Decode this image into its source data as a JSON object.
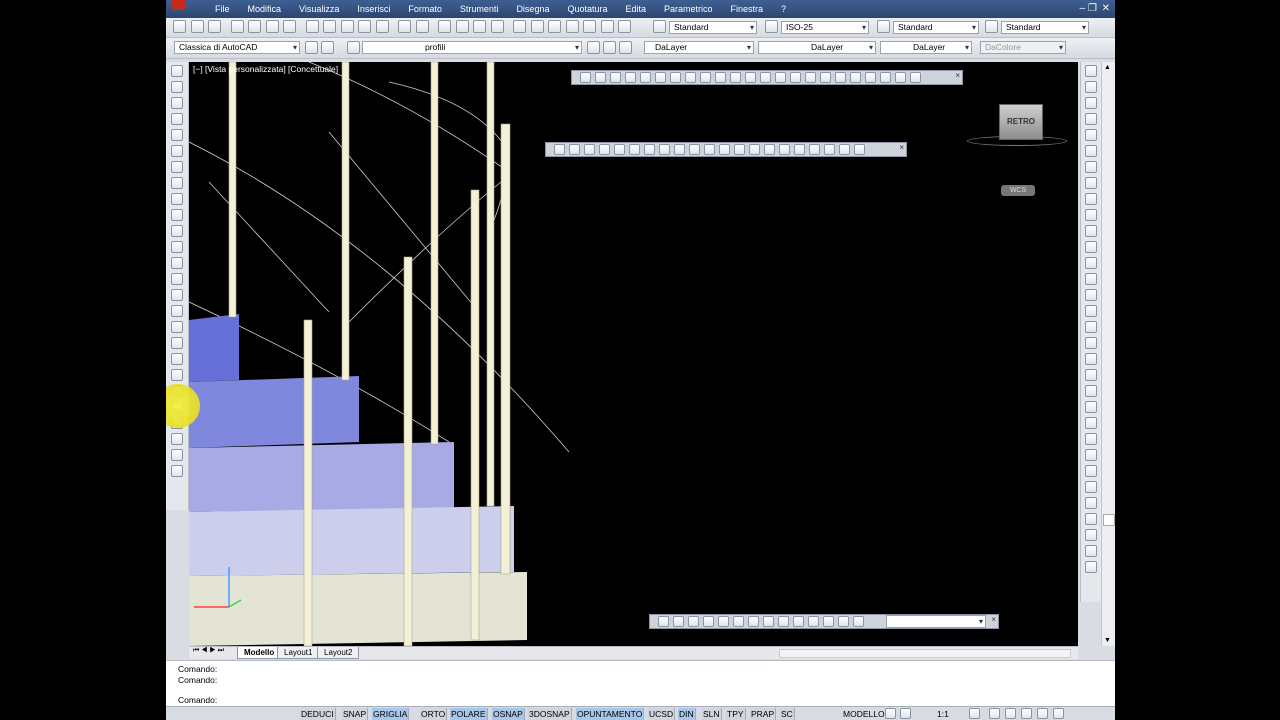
{
  "menubar": {
    "items": [
      "File",
      "Modifica",
      "Visualizza",
      "Inserisci",
      "Formato",
      "Strumenti",
      "Disegna",
      "Quotatura",
      "Edita",
      "Parametrico",
      "Finestra",
      "?"
    ],
    "minimize": "–",
    "restore": "❐",
    "close": "✕"
  },
  "toolbar1": {
    "text_style": "Standard",
    "dim_style": "ISO-25",
    "table_style": "Standard",
    "multileader_style": "Standard"
  },
  "toolbar2": {
    "workspace": "Classica di AutoCAD",
    "layer": "profili",
    "color": "DaLayer",
    "linetype": "DaLayer",
    "lineweight": "DaLayer",
    "plotstyle": "DaColore"
  },
  "viewport": {
    "label": "[−] [Vista personalizzata] [Concettuale]",
    "viewcube_label": "RETRO",
    "wcs_label": "WCS"
  },
  "tabs": {
    "model": "Modello",
    "layout1": "Layout1",
    "layout2": "Layout2"
  },
  "command": {
    "line1": "Comando:",
    "line2": "Comando:",
    "prompt": "Comando:"
  },
  "status": {
    "buttons": [
      "DEDUCI",
      "SNAP",
      "GRIGLIA",
      "ORTO",
      "POLARE",
      "OSNAP",
      "3DOSNAP",
      "OPUNTAMENTO",
      "UCSD",
      "DIN",
      "SLN",
      "TPY",
      "PRAP",
      "SC"
    ],
    "model": "MODELLO",
    "scale": "1:1"
  },
  "colors": {
    "accent": "#2c4670",
    "viewport_bg": "#000000",
    "highlight": "#f0e926"
  }
}
